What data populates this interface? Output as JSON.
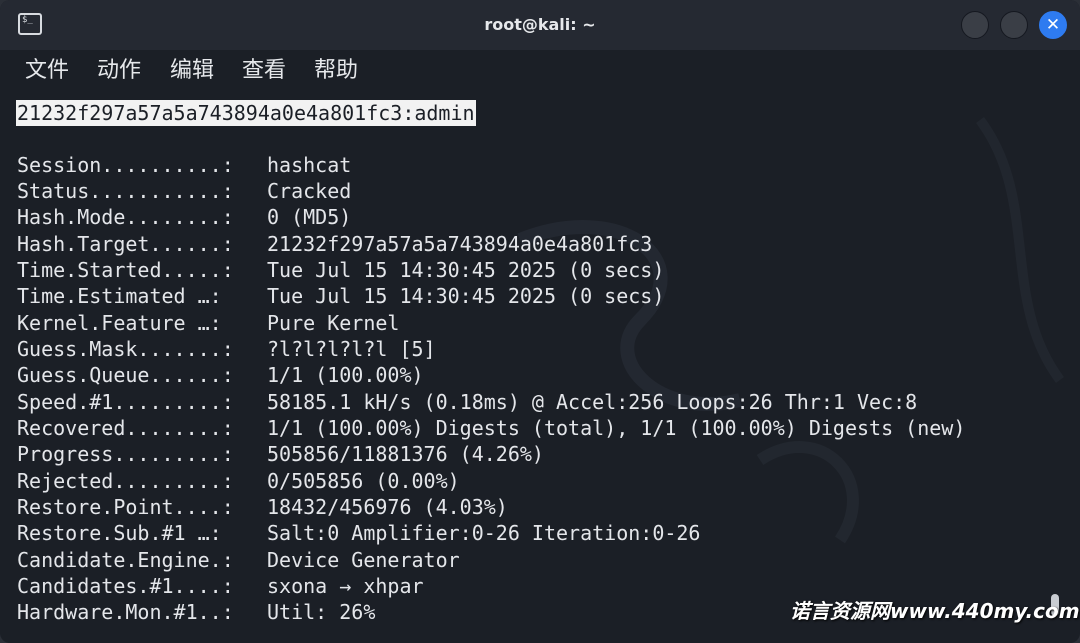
{
  "window": {
    "title": "root@kali: ~",
    "close_glyph": "✕",
    "terminal_icon_glyph": "$_"
  },
  "menu": {
    "file": "文件",
    "action": "动作",
    "edit": "编辑",
    "view": "查看",
    "help": "帮助"
  },
  "terminal": {
    "cracked_line": "21232f297a57a5a743894a0e4a801fc3:admin",
    "rows": [
      {
        "key": "Session..........:",
        "value": "hashcat"
      },
      {
        "key": "Status...........:",
        "value": "Cracked"
      },
      {
        "key": "Hash.Mode........:",
        "value": "0 (MD5)"
      },
      {
        "key": "Hash.Target......:",
        "value": "21232f297a57a5a743894a0e4a801fc3"
      },
      {
        "key": "Time.Started.....:",
        "value": "Tue Jul 15 14:30:45 2025 (0 secs)"
      },
      {
        "key": "Time.Estimated …:",
        "value": "Tue Jul 15 14:30:45 2025 (0 secs)"
      },
      {
        "key": "Kernel.Feature …:",
        "value": "Pure Kernel"
      },
      {
        "key": "Guess.Mask.......:",
        "value": "?l?l?l?l?l [5]"
      },
      {
        "key": "Guess.Queue......:",
        "value": "1/1 (100.00%)"
      },
      {
        "key": "Speed.#1.........:",
        "value": "58185.1 kH/s (0.18ms) @ Accel:256 Loops:26 Thr:1 Vec:8"
      },
      {
        "key": "Recovered........:",
        "value": "1/1 (100.00%) Digests (total), 1/1 (100.00%) Digests (new)"
      },
      {
        "key": "Progress.........:",
        "value": "505856/11881376 (4.26%)"
      },
      {
        "key": "Rejected.........:",
        "value": "0/505856 (0.00%)"
      },
      {
        "key": "Restore.Point....:",
        "value": "18432/456976 (4.03%)"
      },
      {
        "key": "Restore.Sub.#1 …:",
        "value": "Salt:0 Amplifier:0-26 Iteration:0-26"
      },
      {
        "key": "Candidate.Engine.:",
        "value": "Device Generator"
      },
      {
        "key": "Candidates.#1....:",
        "value": "sxona → xhpar"
      },
      {
        "key": "Hardware.Mon.#1..:",
        "value": "Util: 26%"
      }
    ]
  },
  "watermark": "诺言资源网www.440my.com",
  "colors": {
    "background": "#1b1f26",
    "titlebar": "#252932",
    "text": "#e4e6ea",
    "highlight_bg": "#f2f2f2",
    "close_button": "#2e7bf0"
  }
}
